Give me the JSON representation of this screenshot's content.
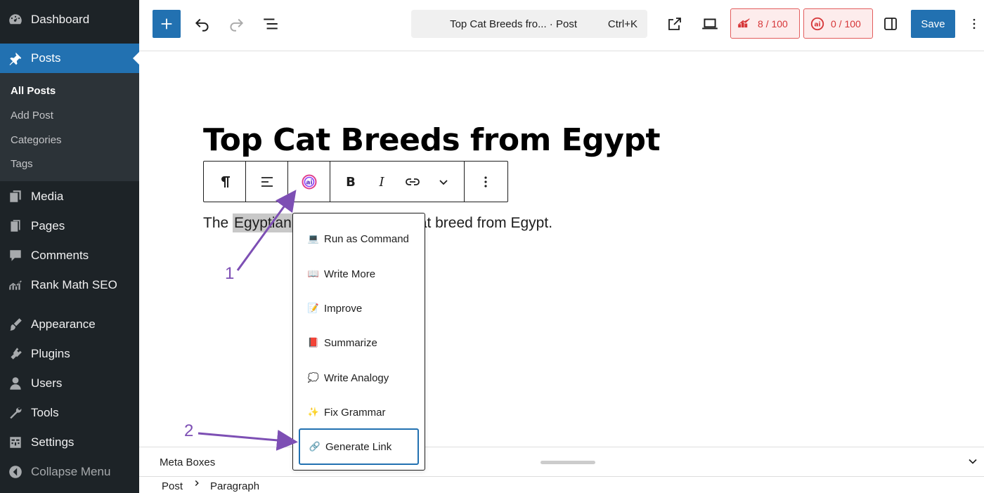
{
  "sidebar": {
    "items": [
      {
        "label": "Dashboard",
        "icon": "dashboard-icon"
      },
      {
        "label": "Posts",
        "icon": "pin-icon"
      },
      {
        "label": "Media",
        "icon": "media-icon"
      },
      {
        "label": "Pages",
        "icon": "pages-icon"
      },
      {
        "label": "Comments",
        "icon": "comments-icon"
      },
      {
        "label": "Rank Math SEO",
        "icon": "rank-math-icon"
      },
      {
        "label": "Appearance",
        "icon": "brush-icon"
      },
      {
        "label": "Plugins",
        "icon": "plugin-icon"
      },
      {
        "label": "Users",
        "icon": "users-icon"
      },
      {
        "label": "Tools",
        "icon": "wrench-icon"
      },
      {
        "label": "Settings",
        "icon": "settings-icon"
      },
      {
        "label": "Collapse Menu",
        "icon": "collapse-icon"
      }
    ],
    "submenu": [
      "All Posts",
      "Add Post",
      "Categories",
      "Tags"
    ]
  },
  "topbar": {
    "command_title": "Top Cat Breeds fro... · Post",
    "command_shortcut": "Ctrl+K",
    "seo_score": "8 / 100",
    "content_ai_score": "0 / 100",
    "save_label": "Save"
  },
  "editor": {
    "title": "Top Cat Breeds from Egypt",
    "paragraph_before": "The ",
    "paragraph_highlight": "Egyptian Mau",
    "paragraph_after": " is a cat breed from Egypt.",
    "paragraph_visible_highlight": "Egyptian",
    "paragraph_visible_tail": "at breed from Egypt."
  },
  "ai_menu": {
    "items": [
      {
        "emoji": "💻",
        "label": "Run as Command"
      },
      {
        "emoji": "📖",
        "label": "Write More"
      },
      {
        "emoji": "📝",
        "label": "Improve"
      },
      {
        "emoji": "📕",
        "label": "Summarize"
      },
      {
        "emoji": "💭",
        "label": "Write Analogy"
      },
      {
        "emoji": "✨",
        "label": "Fix Grammar"
      },
      {
        "emoji": "🔗",
        "label": "Generate Link"
      }
    ]
  },
  "bottom": {
    "meta_boxes": "Meta Boxes",
    "breadcrumb": [
      "Post",
      "Paragraph"
    ]
  },
  "annotations": {
    "step1": "1",
    "step2": "2"
  },
  "colors": {
    "accent": "#2271b1",
    "sidebar_bg": "#1d2327",
    "annotation": "#7d4fb4",
    "score": "#d63638"
  }
}
